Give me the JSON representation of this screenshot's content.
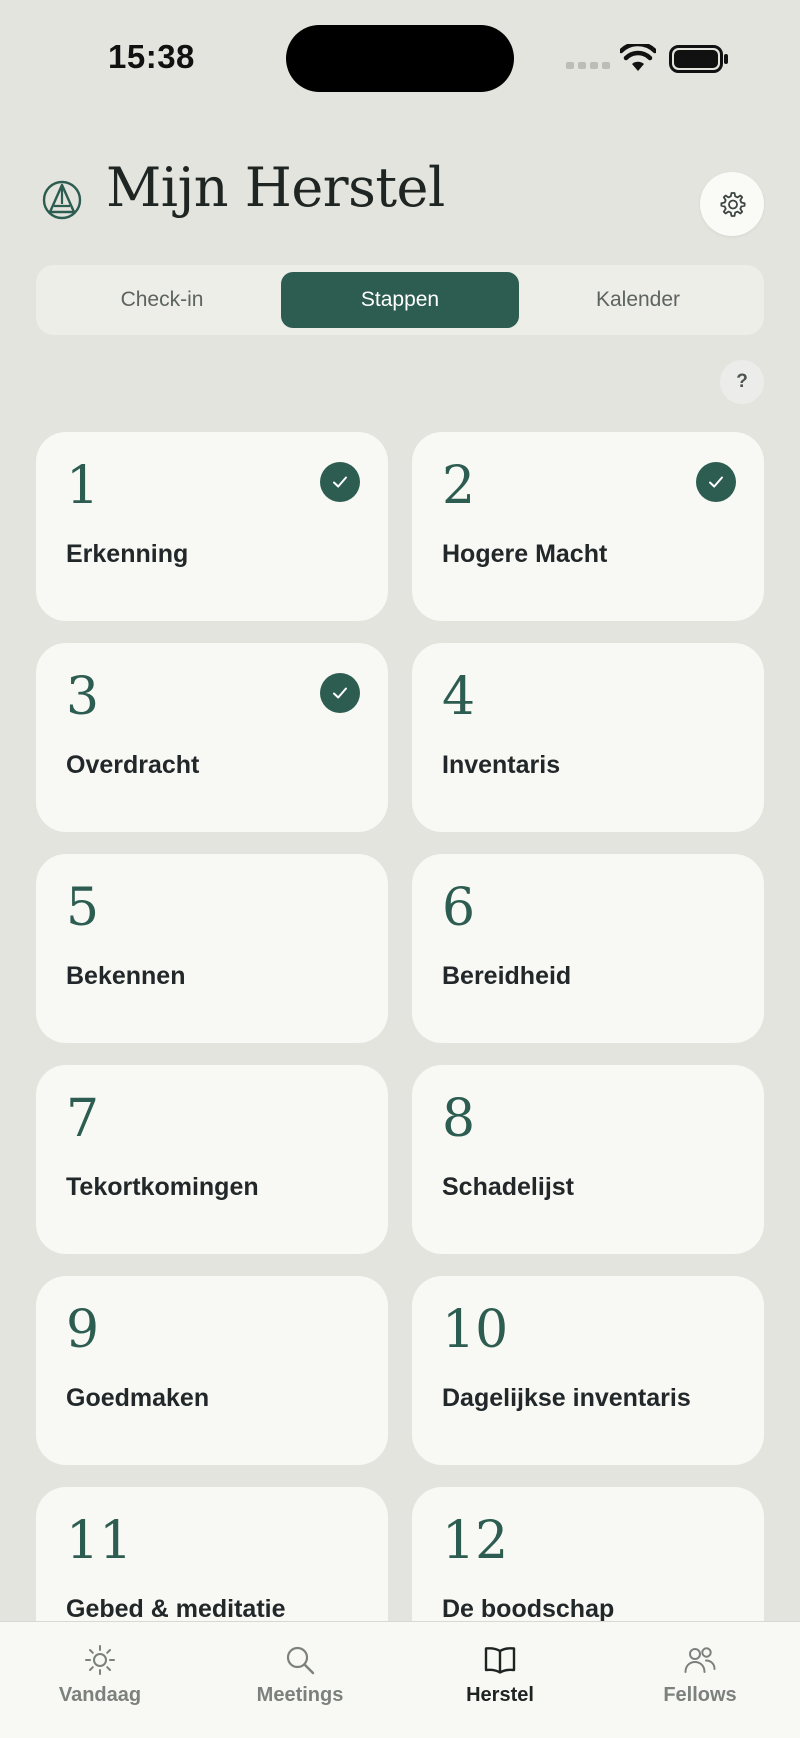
{
  "status_bar": {
    "time": "15:38"
  },
  "header": {
    "title": "Mijn Herstel"
  },
  "tabs": [
    {
      "label": "Check-in",
      "active": false
    },
    {
      "label": "Stappen",
      "active": true
    },
    {
      "label": "Kalender",
      "active": false
    }
  ],
  "help_label": "?",
  "steps": [
    {
      "number": "1",
      "name": "Erkenning",
      "completed": true
    },
    {
      "number": "2",
      "name": "Hogere Macht",
      "completed": true
    },
    {
      "number": "3",
      "name": "Overdracht",
      "completed": true
    },
    {
      "number": "4",
      "name": "Inventaris",
      "completed": false
    },
    {
      "number": "5",
      "name": "Bekennen",
      "completed": false
    },
    {
      "number": "6",
      "name": "Bereidheid",
      "completed": false
    },
    {
      "number": "7",
      "name": "Tekortkomingen",
      "completed": false
    },
    {
      "number": "8",
      "name": "Schadelijst",
      "completed": false
    },
    {
      "number": "9",
      "name": "Goedmaken",
      "completed": false
    },
    {
      "number": "10",
      "name": "Dagelijkse inventaris",
      "completed": false
    },
    {
      "number": "11",
      "name": "Gebed & meditatie",
      "completed": false
    },
    {
      "number": "12",
      "name": "De boodschap",
      "completed": false
    }
  ],
  "bottom_nav": [
    {
      "label": "Vandaag",
      "icon": "sun-icon",
      "active": false
    },
    {
      "label": "Meetings",
      "icon": "search-icon",
      "active": false
    },
    {
      "label": "Herstel",
      "icon": "book-icon",
      "active": true
    },
    {
      "label": "Fellows",
      "icon": "people-icon",
      "active": false
    }
  ],
  "colors": {
    "accent": "#2d5c50",
    "background": "#e4e4de",
    "card": "#f8f8f4"
  }
}
